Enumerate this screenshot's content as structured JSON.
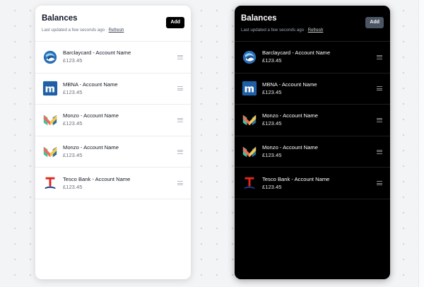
{
  "colors": {
    "light_bg": "#ffffff",
    "dark_bg": "#000000",
    "barclaycard": "#2a6fb5",
    "mbna": "#1f5fa6",
    "monzo_coral": "#ee6b5a",
    "monzo_green": "#3ec4a0",
    "monzo_yellow": "#f5c84c",
    "monzo_blue": "#2b6fa0",
    "tesco_red": "#e1261c",
    "tesco_blue": "#1d3a8a"
  },
  "panels": [
    {
      "theme": "light",
      "title": "Balances",
      "subtitle_prefix": "Last updated a few seconds ago · ",
      "refresh_label": "Refresh",
      "add_label": "Add",
      "accounts": [
        {
          "name": "Barclaycard - Account Name",
          "balance": "£123.45",
          "logo": "barclaycard-logo-icon"
        },
        {
          "name": "MBNA - Account Name",
          "balance": "£123.45",
          "logo": "mbna-logo-icon"
        },
        {
          "name": "Monzo - Account Name",
          "balance": "£123.45",
          "logo": "monzo-logo-icon"
        },
        {
          "name": "Monzo - Account Name",
          "balance": "£123.45",
          "logo": "monzo-logo-icon"
        },
        {
          "name": "Tesco Bank - Account Name",
          "balance": "£123.45",
          "logo": "tesco-bank-logo-icon"
        }
      ]
    },
    {
      "theme": "dark",
      "title": "Balances",
      "subtitle_prefix": "Last updated a few seconds ago · ",
      "refresh_label": "Refresh",
      "add_label": "Add",
      "accounts": [
        {
          "name": "Barclaycard - Account Name",
          "balance": "£123.45",
          "logo": "barclaycard-logo-icon"
        },
        {
          "name": "MBNA - Account Name",
          "balance": "£123.45",
          "logo": "mbna-logo-icon"
        },
        {
          "name": "Monzo - Account Name",
          "balance": "£123.45",
          "logo": "monzo-logo-icon"
        },
        {
          "name": "Monzo - Account Name",
          "balance": "£123.45",
          "logo": "monzo-logo-icon"
        },
        {
          "name": "Tesco Bank - Account Name",
          "balance": "£123.45",
          "logo": "tesco-bank-logo-icon"
        }
      ]
    }
  ]
}
